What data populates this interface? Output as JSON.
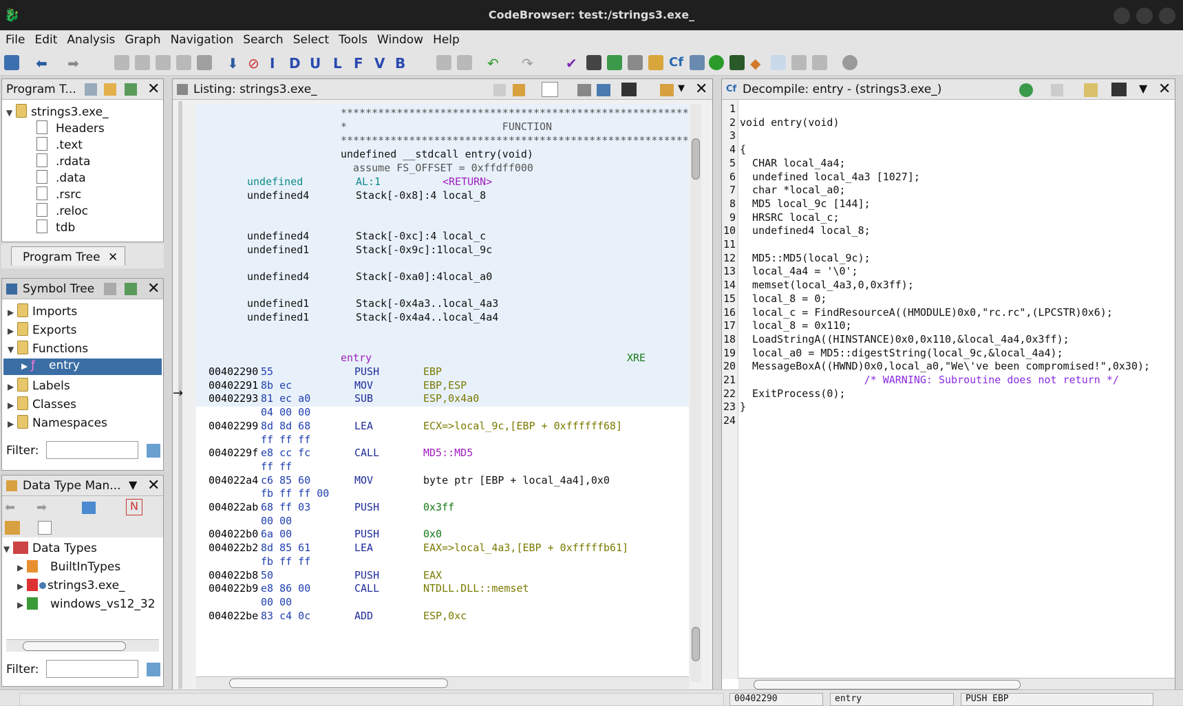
{
  "window": {
    "title": "CodeBrowser: test:/strings3.exe_"
  },
  "menu": [
    "File",
    "Edit",
    "Analysis",
    "Graph",
    "Navigation",
    "Search",
    "Select",
    "Tools",
    "Window",
    "Help"
  ],
  "program_tree": {
    "title": "Program T...",
    "tab": "Program Tree",
    "root": "strings3.exe_",
    "items": [
      "Headers",
      ".text",
      ".rdata",
      ".data",
      ".rsrc",
      ".reloc",
      "tdb"
    ]
  },
  "symbol_tree": {
    "title": "Symbol Tree",
    "items": [
      "Imports",
      "Exports",
      "Functions",
      "entry",
      "Labels",
      "Classes",
      "Namespaces"
    ],
    "filter_label": "Filter:"
  },
  "data_types": {
    "title": "Data Type Man...",
    "root": "Data Types",
    "items": [
      "BuiltInTypes",
      "strings3.exe_",
      "windows_vs12_32"
    ],
    "filter_label": "Filter:"
  },
  "listing": {
    "title": "Listing:  strings3.exe_",
    "header": [
      {
        "c": "c-star",
        "t": "**************************************************************"
      },
      {
        "c": "c-star",
        "t": "*                         FUNCTION"
      },
      {
        "c": "c-star",
        "t": "**************************************************************"
      },
      {
        "c": "",
        "t": "undefined __stdcall entry(void)"
      },
      {
        "c": "c-star",
        "t": "  assume FS_OFFSET = 0xffdff000"
      }
    ],
    "vars": [
      {
        "type": "undefined",
        "loc": "AL:1",
        "name": "<RETURN>"
      },
      {
        "type": "undefined4",
        "loc": "Stack[-0x8]:4",
        "name": "local_8"
      },
      {
        "type": "undefined4",
        "loc": "Stack[-0xc]:4",
        "name": "local_c"
      },
      {
        "type": "undefined1",
        "loc": "Stack[-0x9c]:1",
        "name": "local_9c"
      },
      {
        "type": "undefined4",
        "loc": "Stack[-0xa0]:4",
        "name": "local_a0"
      },
      {
        "type": "undefined1",
        "loc": "Stack[-0x4a3...",
        "name": "local_4a3"
      },
      {
        "type": "undefined1",
        "loc": "Stack[-0x4a4...",
        "name": "local_4a4"
      }
    ],
    "label": "entry",
    "xref": "XRE",
    "code": [
      {
        "addr": "00402290",
        "bytes": "55",
        "mn": "PUSH",
        "op": "EBP"
      },
      {
        "addr": "00402291",
        "bytes": "8b ec",
        "mn": "MOV",
        "op": "EBP,ESP"
      },
      {
        "addr": "00402293",
        "bytes": "81 ec a0",
        "mn": "SUB",
        "op": "ESP,0x4a0"
      },
      {
        "addr": "",
        "bytes": "04 00 00",
        "mn": "",
        "op": ""
      },
      {
        "addr": "00402299",
        "bytes": "8d 8d 68",
        "mn": "LEA",
        "op": "ECX=>local_9c,[EBP + 0xffffff68]"
      },
      {
        "addr": "",
        "bytes": "ff ff ff",
        "mn": "",
        "op": ""
      },
      {
        "addr": "0040229f",
        "bytes": "e8 cc fc",
        "mn": "CALL",
        "op": "MD5::MD5"
      },
      {
        "addr": "",
        "bytes": "ff ff",
        "mn": "",
        "op": ""
      },
      {
        "addr": "004022a4",
        "bytes": "c6 85 60",
        "mn": "MOV",
        "op": "byte ptr [EBP + local_4a4],0x0"
      },
      {
        "addr": "",
        "bytes": "fb ff ff 00",
        "mn": "",
        "op": ""
      },
      {
        "addr": "004022ab",
        "bytes": "68 ff 03",
        "mn": "PUSH",
        "op": "0x3ff"
      },
      {
        "addr": "",
        "bytes": "00 00",
        "mn": "",
        "op": ""
      },
      {
        "addr": "004022b0",
        "bytes": "6a 00",
        "mn": "PUSH",
        "op": "0x0"
      },
      {
        "addr": "004022b2",
        "bytes": "8d 85 61",
        "mn": "LEA",
        "op": "EAX=>local_4a3,[EBP + 0xfffffb61]"
      },
      {
        "addr": "",
        "bytes": "fb ff ff",
        "mn": "",
        "op": ""
      },
      {
        "addr": "004022b8",
        "bytes": "50",
        "mn": "PUSH",
        "op": "EAX"
      },
      {
        "addr": "004022b9",
        "bytes": "e8 86 00",
        "mn": "CALL",
        "op": "NTDLL.DLL::memset"
      },
      {
        "addr": "",
        "bytes": "00 00",
        "mn": "",
        "op": ""
      },
      {
        "addr": "004022be",
        "bytes": "83 c4 0c",
        "mn": "ADD",
        "op": "ESP,0xc"
      }
    ]
  },
  "decompile": {
    "title": "Decompile: entry -  (strings3.exe_)",
    "lines": [
      "",
      "void entry(void)",
      "",
      "{",
      "  CHAR local_4a4;",
      "  undefined local_4a3 [1027];",
      "  char *local_a0;",
      "  MD5 local_9c [144];",
      "  HRSRC local_c;",
      "  undefined4 local_8;",
      "",
      "  MD5::MD5(local_9c);",
      "  local_4a4 = '\\0';",
      "  memset(local_4a3,0,0x3ff);",
      "  local_8 = 0;",
      "  local_c = FindResourceA((HMODULE)0x0,\"rc.rc\",(LPCSTR)0x6);",
      "  local_8 = 0x110;",
      "  LoadStringA((HINSTANCE)0x0,0x110,&local_4a4,0x3ff);",
      "  local_a0 = MD5::digestString(local_9c,&local_4a4);",
      "  MessageBoxA((HWND)0x0,local_a0,\"We\\'ve been compromised!\",0x30);",
      "                    /* WARNING: Subroutine does not return */",
      "  ExitProcess(0);",
      "}",
      ""
    ]
  },
  "status": {
    "address": "00402290",
    "function": "entry",
    "instruction": "PUSH EBP"
  }
}
